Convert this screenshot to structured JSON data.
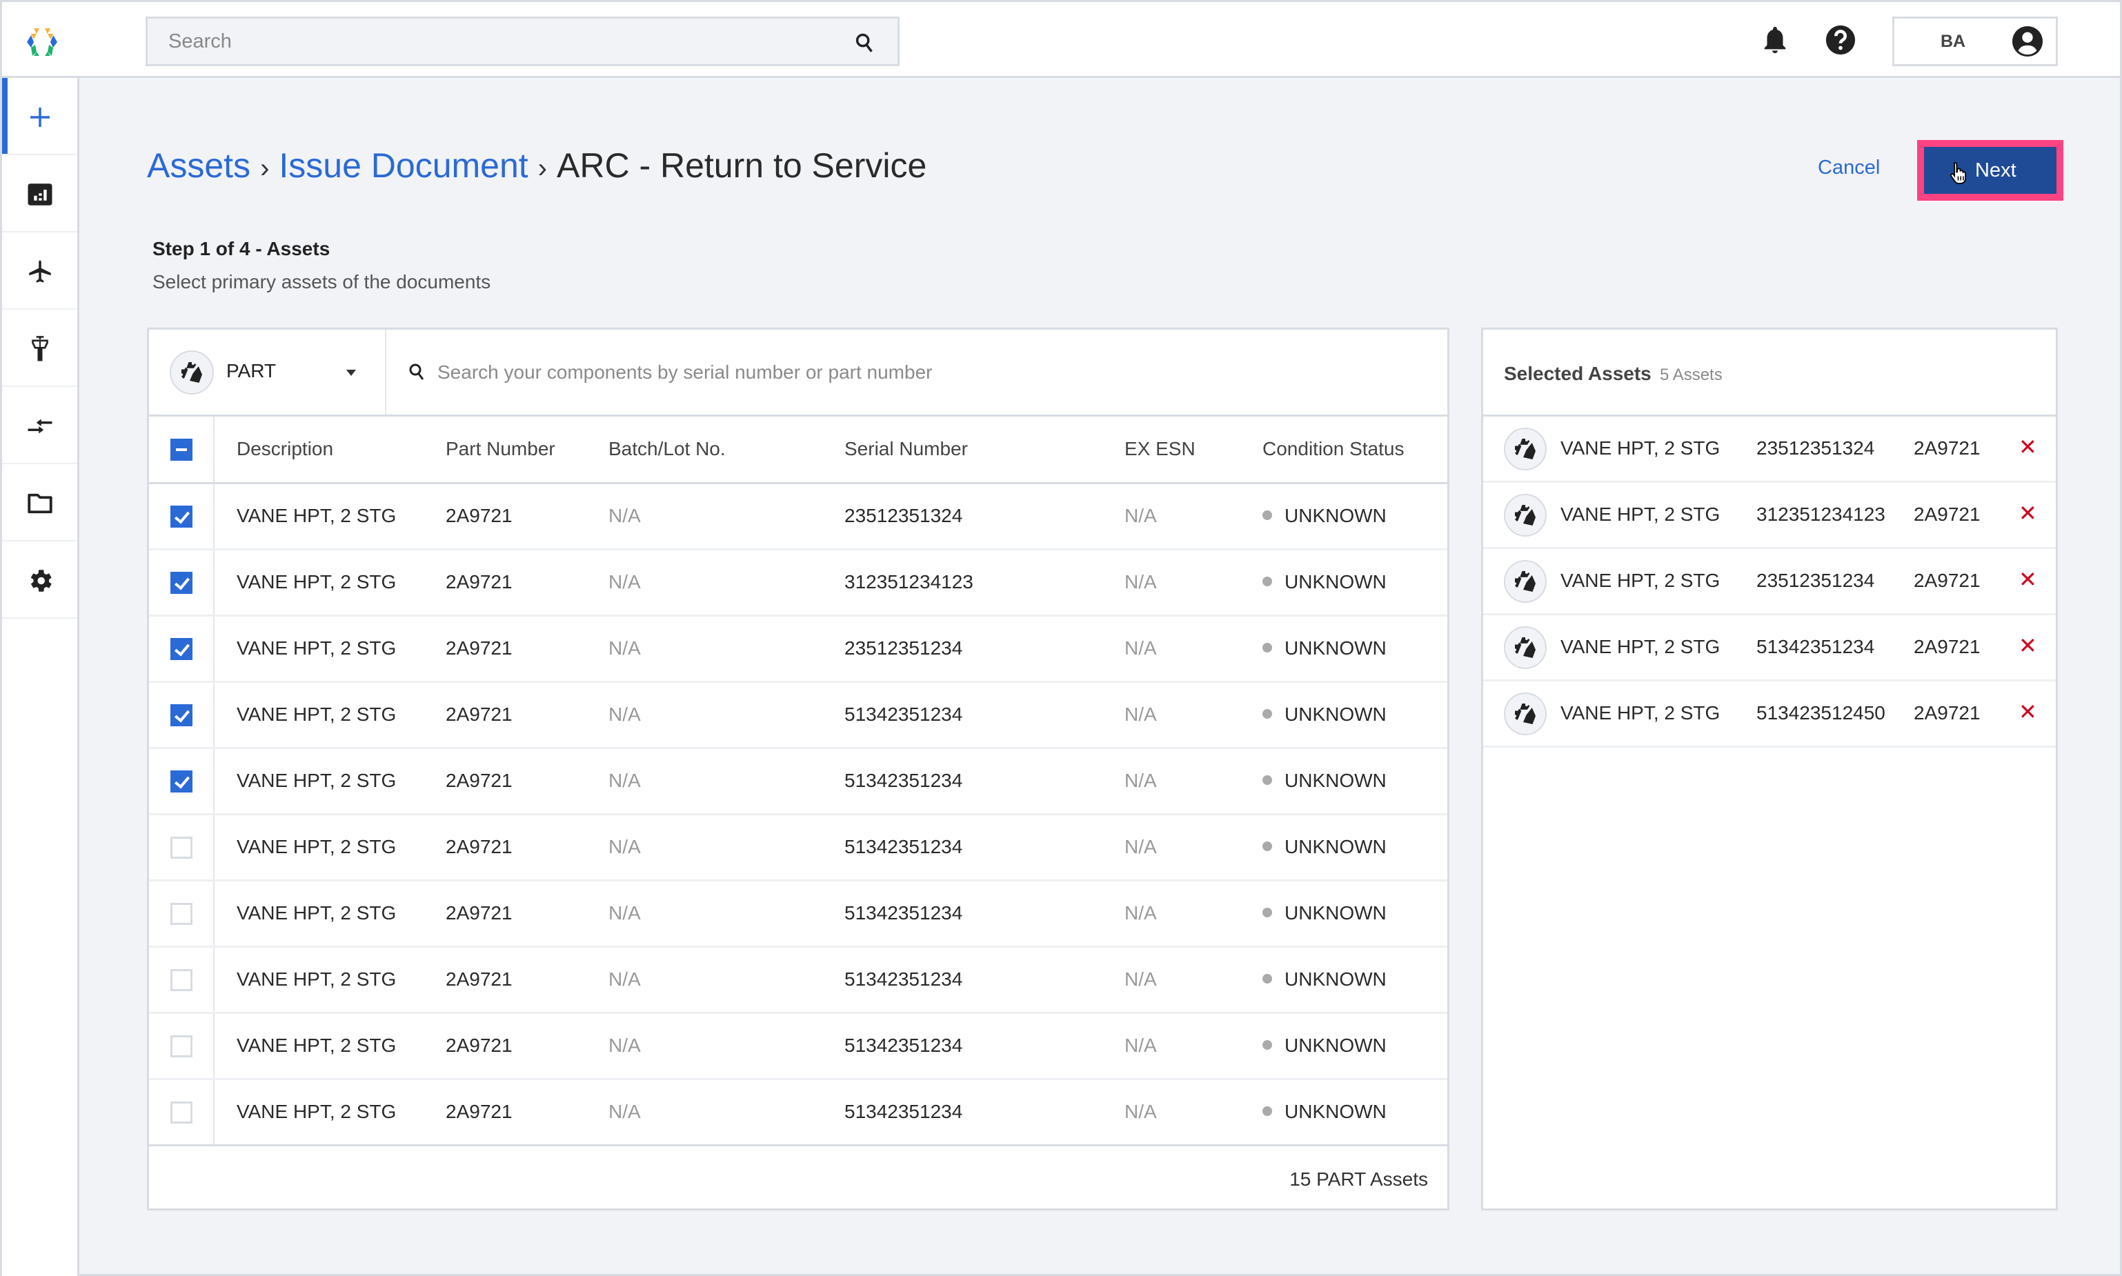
{
  "topbar": {
    "search_placeholder": "Search",
    "user_initials": "BA"
  },
  "sidebar": {
    "items": [
      {
        "id": "add",
        "icon": "plus-icon",
        "active": true
      },
      {
        "id": "dashboard",
        "icon": "dashboard-icon",
        "active": false
      },
      {
        "id": "aircraft",
        "icon": "airplane-icon",
        "active": false
      },
      {
        "id": "airport",
        "icon": "control-tower-icon",
        "active": false
      },
      {
        "id": "transfer",
        "icon": "transfer-arrows-icon",
        "active": false
      },
      {
        "id": "documents",
        "icon": "folder-icon",
        "active": false
      },
      {
        "id": "settings",
        "icon": "gear-icon",
        "active": false
      }
    ]
  },
  "header": {
    "breadcrumb": [
      "Assets",
      "Issue Document",
      "ARC - Return to Service"
    ],
    "separator": "›",
    "cancel_label": "Cancel",
    "next_label": "Next"
  },
  "step": {
    "title": "Step 1 of 4 - Assets",
    "subtitle": "Select primary assets of the documents"
  },
  "filter": {
    "type_selected": "PART",
    "search_placeholder": "Search your components by serial number or part number"
  },
  "table": {
    "columns": [
      "Description",
      "Part Number",
      "Batch/Lot No.",
      "Serial Number",
      "EX ESN",
      "Condition Status"
    ],
    "rows": [
      {
        "checked": true,
        "description": "VANE HPT, 2 STG",
        "part_number": "2A9721",
        "batch": "N/A",
        "serial": "23512351324",
        "ex_esn": "N/A",
        "status": "UNKNOWN"
      },
      {
        "checked": true,
        "description": "VANE HPT, 2 STG",
        "part_number": "2A9721",
        "batch": "N/A",
        "serial": "312351234123",
        "ex_esn": "N/A",
        "status": "UNKNOWN"
      },
      {
        "checked": true,
        "description": "VANE HPT, 2 STG",
        "part_number": "2A9721",
        "batch": "N/A",
        "serial": "23512351234",
        "ex_esn": "N/A",
        "status": "UNKNOWN"
      },
      {
        "checked": true,
        "description": "VANE HPT, 2 STG",
        "part_number": "2A9721",
        "batch": "N/A",
        "serial": "51342351234",
        "ex_esn": "N/A",
        "status": "UNKNOWN"
      },
      {
        "checked": true,
        "description": "VANE HPT, 2 STG",
        "part_number": "2A9721",
        "batch": "N/A",
        "serial": "51342351234",
        "ex_esn": "N/A",
        "status": "UNKNOWN"
      },
      {
        "checked": false,
        "description": "VANE HPT, 2 STG",
        "part_number": "2A9721",
        "batch": "N/A",
        "serial": "51342351234",
        "ex_esn": "N/A",
        "status": "UNKNOWN"
      },
      {
        "checked": false,
        "description": "VANE HPT, 2 STG",
        "part_number": "2A9721",
        "batch": "N/A",
        "serial": "51342351234",
        "ex_esn": "N/A",
        "status": "UNKNOWN"
      },
      {
        "checked": false,
        "description": "VANE HPT, 2 STG",
        "part_number": "2A9721",
        "batch": "N/A",
        "serial": "51342351234",
        "ex_esn": "N/A",
        "status": "UNKNOWN"
      },
      {
        "checked": false,
        "description": "VANE HPT, 2 STG",
        "part_number": "2A9721",
        "batch": "N/A",
        "serial": "51342351234",
        "ex_esn": "N/A",
        "status": "UNKNOWN"
      },
      {
        "checked": false,
        "description": "VANE HPT, 2 STG",
        "part_number": "2A9721",
        "batch": "N/A",
        "serial": "51342351234",
        "ex_esn": "N/A",
        "status": "UNKNOWN"
      }
    ],
    "footer": "15 PART Assets"
  },
  "selected": {
    "title": "Selected Assets",
    "count_label": "5 Assets",
    "remove_glyph": "✕",
    "items": [
      {
        "description": "VANE HPT, 2 STG",
        "serial": "23512351324",
        "part_number": "2A9721"
      },
      {
        "description": "VANE HPT, 2 STG",
        "serial": "312351234123",
        "part_number": "2A9721"
      },
      {
        "description": "VANE HPT, 2 STG",
        "serial": "23512351234",
        "part_number": "2A9721"
      },
      {
        "description": "VANE HPT, 2 STG",
        "serial": "51342351234",
        "part_number": "2A9721"
      },
      {
        "description": "VANE HPT, 2 STG",
        "serial": "513423512450",
        "part_number": "2A9721"
      }
    ]
  },
  "colors": {
    "accent": "#2a6ad6",
    "primary_button": "#1f4b96",
    "highlight": "#ff4281",
    "remove": "#d0021b",
    "status_unknown": "#aaaaaa"
  }
}
